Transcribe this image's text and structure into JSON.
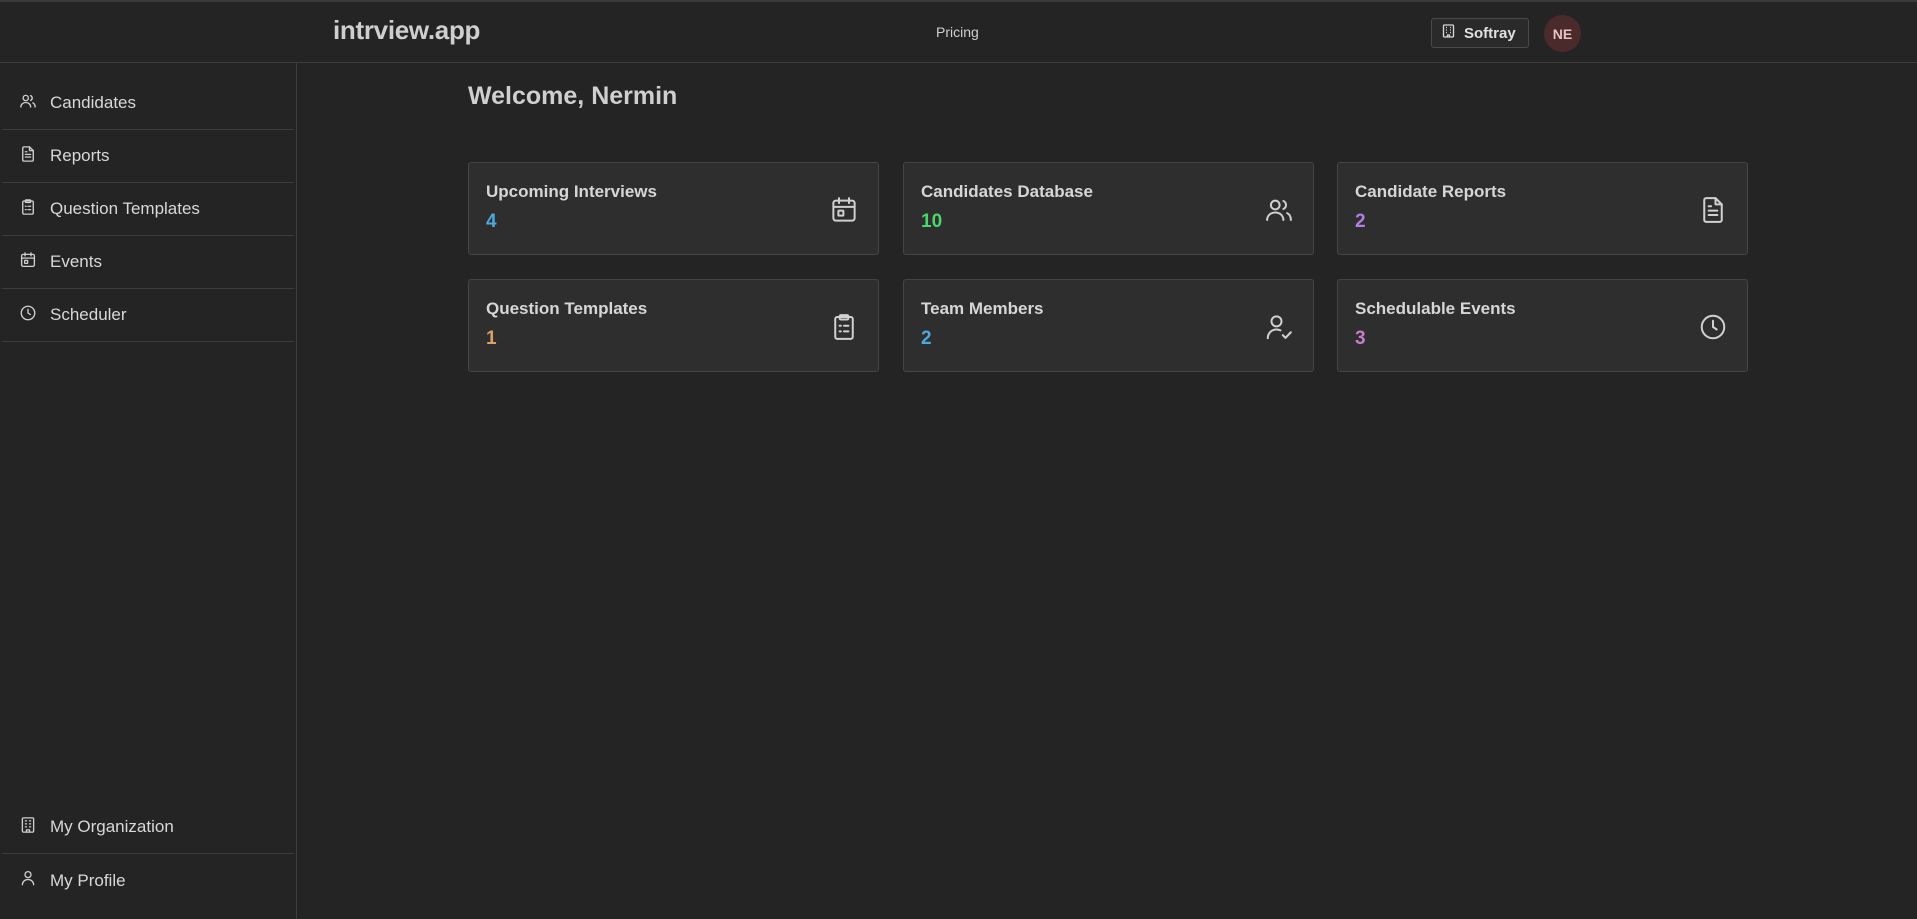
{
  "header": {
    "logo": "intrview.app",
    "pricing_link": "Pricing",
    "org_button_label": "Softray",
    "org_icon": "building-icon",
    "avatar_initials": "NE"
  },
  "sidebar": {
    "items": [
      {
        "label": "Candidates",
        "icon": "users-icon"
      },
      {
        "label": "Reports",
        "icon": "document-icon"
      },
      {
        "label": "Question Templates",
        "icon": "clipboard-icon"
      },
      {
        "label": "Events",
        "icon": "calendar-icon"
      },
      {
        "label": "Scheduler",
        "icon": "clock-icon"
      }
    ],
    "bottom_items": [
      {
        "label": "My Organization",
        "icon": "building-icon"
      },
      {
        "label": "My Profile",
        "icon": "user-icon"
      }
    ]
  },
  "main": {
    "welcome": "Welcome, Nermin",
    "cards": [
      {
        "title": "Upcoming Interviews",
        "value": "4",
        "color": "#4ea8de",
        "icon": "calendar-icon"
      },
      {
        "title": "Candidates Database",
        "value": "10",
        "color": "#4ad66d",
        "icon": "users-icon"
      },
      {
        "title": "Candidate Reports",
        "value": "2",
        "color": "#b07fe0",
        "icon": "document-icon"
      },
      {
        "title": "Question Templates",
        "value": "1",
        "color": "#d9a066",
        "icon": "clipboard-icon"
      },
      {
        "title": "Team Members",
        "value": "2",
        "color": "#4ea8de",
        "icon": "user-check-icon"
      },
      {
        "title": "Schedulable Events",
        "value": "3",
        "color": "#c77dca",
        "icon": "clock-icon"
      }
    ]
  }
}
